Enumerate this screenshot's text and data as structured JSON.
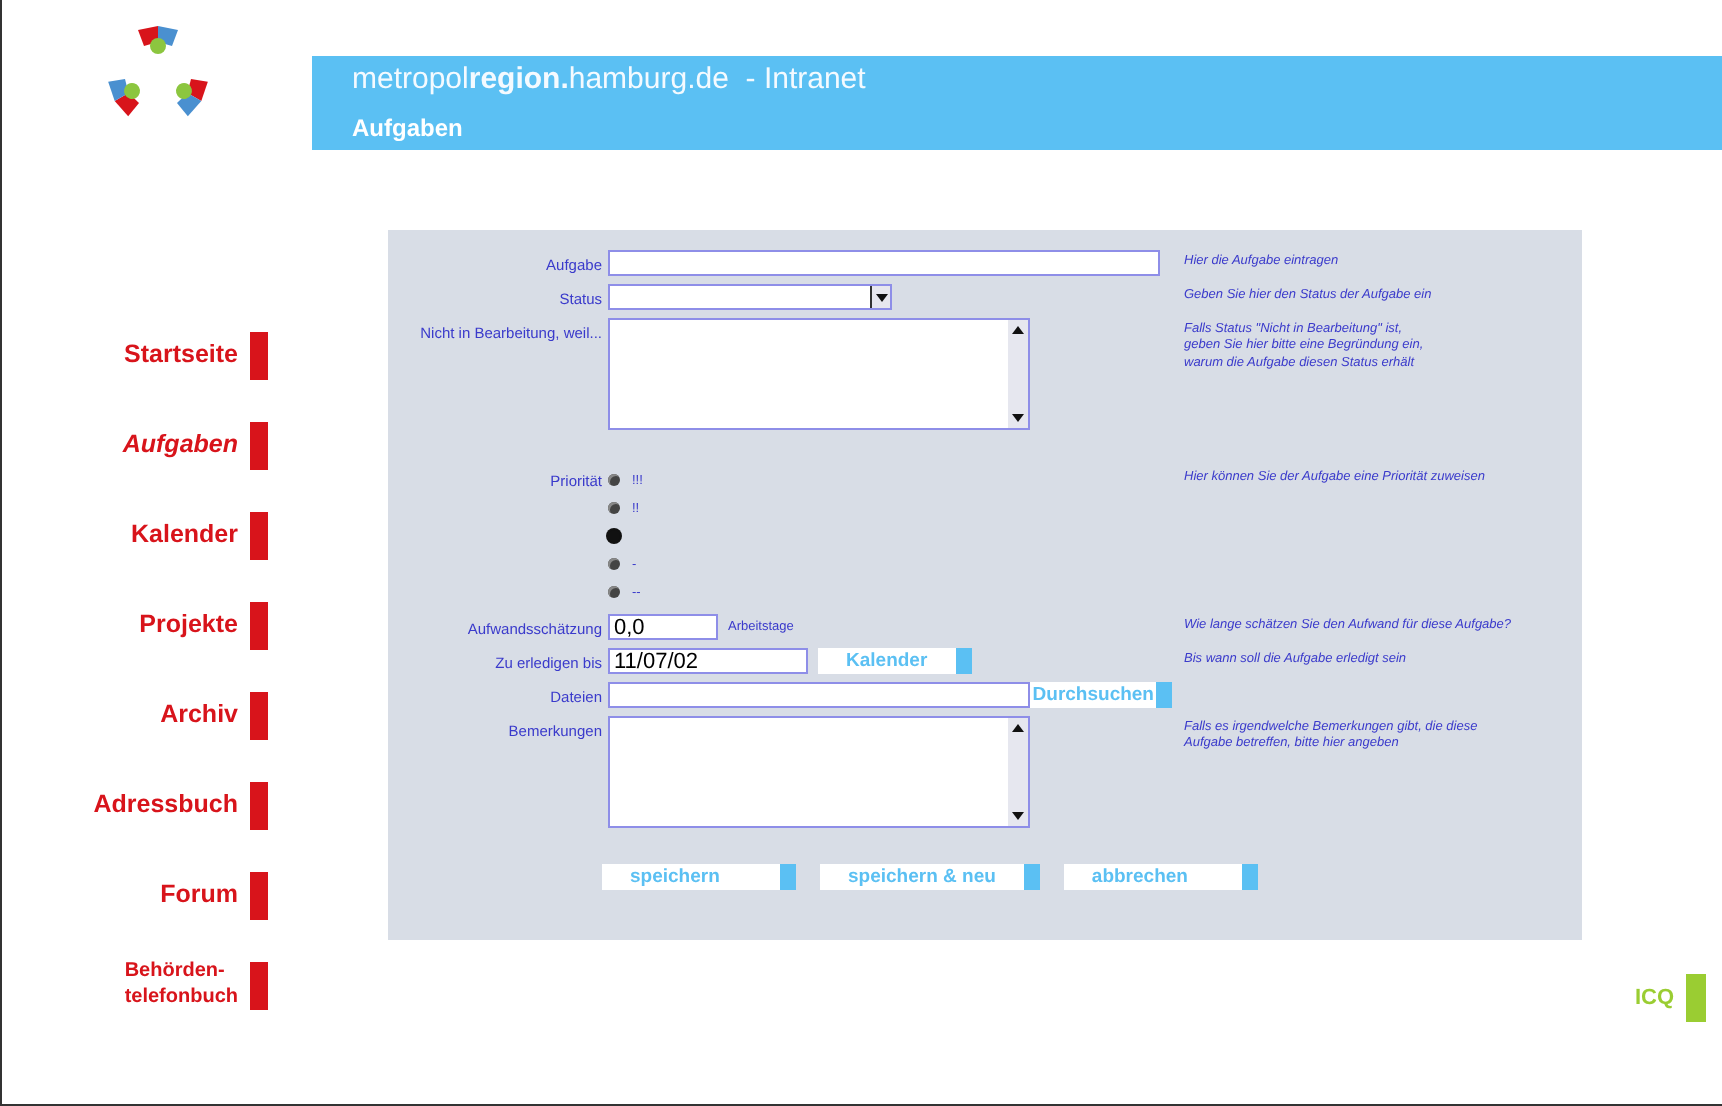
{
  "header": {
    "site_plain_1": "metropol",
    "site_bold": "region.",
    "site_plain_2": "hamburg.de",
    "site_suffix": "- Intranet",
    "section": "Aufgaben"
  },
  "nav": [
    {
      "label": "Startseite",
      "selected": false
    },
    {
      "label": "Aufgaben",
      "selected": true
    },
    {
      "label": "Kalender",
      "selected": false
    },
    {
      "label": "Projekte",
      "selected": false
    },
    {
      "label": "Archiv",
      "selected": false
    },
    {
      "label": "Adressbuch",
      "selected": false
    },
    {
      "label": "Forum",
      "selected": false
    },
    {
      "label": "Behörden-\ntelefonbuch",
      "selected": false
    }
  ],
  "form": {
    "rows": [
      {
        "kind": "text",
        "label": "Aufgabe",
        "value": "",
        "hint": "Hier die Aufgabe eintragen"
      },
      {
        "kind": "select",
        "label": "Status",
        "value": "",
        "hint": "Geben Sie hier den Status der Aufgabe ein"
      },
      {
        "kind": "textarea",
        "label": "Nicht in Bearbeitung, weil...",
        "value": "",
        "hint": "Falls Status \"Nicht in Bearbeitung\" ist,\ngeben Sie hier bitte eine Begründung ein,\nwarum die Aufgabe diesen Status erhält"
      },
      {
        "kind": "radio",
        "label": "Priorität",
        "hint": "Hier können Sie der Aufgabe eine Priorität zuweisen",
        "options": [
          {
            "label": "!!!",
            "selected": false
          },
          {
            "label": "!!",
            "selected": false
          },
          {
            "selected": true
          },
          {
            "label": "-",
            "selected": false
          },
          {
            "label": "--",
            "selected": false
          }
        ]
      },
      {
        "kind": "number",
        "label": "Aufwandsschätzung",
        "value": "0,0",
        "unit": "Arbeitstage",
        "hint": "Wie lange schätzen Sie den Aufwand für diese Aufgabe?"
      },
      {
        "kind": "date",
        "label": "Zu erledigen bis",
        "value": "11/07/02",
        "button": "Kalender",
        "hint": "Bis wann soll die Aufgabe erledigt sein"
      },
      {
        "kind": "file",
        "label": "Dateien",
        "value": "",
        "button": "Durchsuchen"
      },
      {
        "kind": "textarea",
        "label": "Bemerkungen",
        "value": "",
        "hint": "Falls es irgendwelche Bemerkungen gibt, die diese\nAufgabe betreffen, bitte hier angeben"
      }
    ],
    "buttons": [
      "speichern",
      "speichern & neu",
      "abbrechen"
    ]
  },
  "corner_link": "ICQ"
}
